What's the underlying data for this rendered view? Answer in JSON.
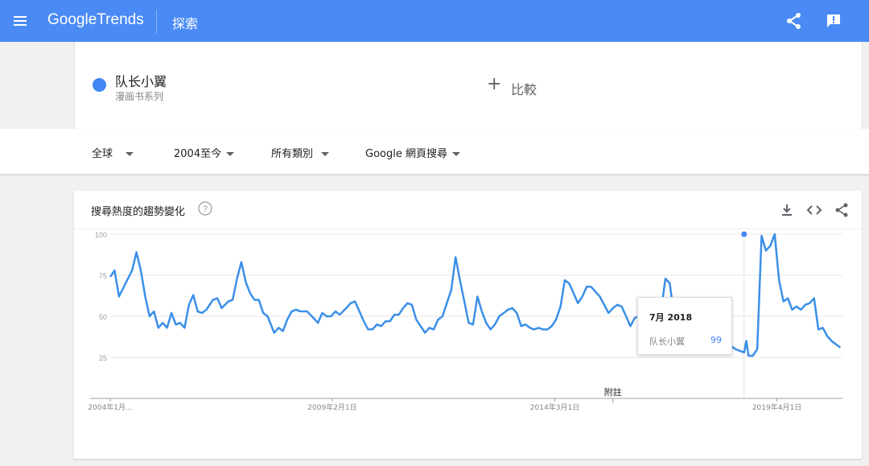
{
  "topbar": {
    "menu_icon": "hamburger-icon",
    "logo_google": "Google",
    "logo_trends": "Trends",
    "app_title": "探索",
    "share_icon": "share-icon",
    "feedback_icon": "feedback-icon"
  },
  "term": {
    "name": "队长小翼",
    "type": "漫画书系列",
    "color": "#4285f4"
  },
  "compare": {
    "label": "比較",
    "icon": "plus-icon"
  },
  "filters": [
    {
      "label": "全球"
    },
    {
      "label": "2004至今"
    },
    {
      "label": "所有類別"
    },
    {
      "label": "Google 網頁搜尋"
    }
  ],
  "chart": {
    "title": "搜尋熱度的趨勢變化",
    "download_icon": "download-icon",
    "embed_icon": "embed-code-icon",
    "share_icon": "share-icon",
    "help_icon": "help-icon",
    "annotation_label": "附註"
  },
  "tooltip": {
    "date": "7月 2018",
    "term": "队长小翼",
    "value": "99"
  },
  "chart_data": {
    "type": "line",
    "line_color": "#3b8fe8",
    "ylim": [
      0,
      100
    ],
    "yticks": [
      100,
      75,
      50,
      25
    ],
    "xtick_labels": [
      {
        "label": "2004年1月...",
        "year": 2004.0
      },
      {
        "label": "2009年2月1日",
        "year": 2009.08
      },
      {
        "label": "2014年3月1日",
        "year": 2014.17
      },
      {
        "label": "2019年4月1日",
        "year": 2019.25
      }
    ],
    "x_start": 2004.0,
    "x_end": 2020.75,
    "highlight": {
      "year": 2018.5,
      "value": 100
    },
    "annotation_year": 2015.5,
    "series": [
      {
        "name": "队长小翼",
        "points": [
          [
            2004.0,
            74
          ],
          [
            2004.1,
            78
          ],
          [
            2004.2,
            62
          ],
          [
            2004.35,
            70
          ],
          [
            2004.5,
            78
          ],
          [
            2004.6,
            89
          ],
          [
            2004.7,
            78
          ],
          [
            2004.8,
            62
          ],
          [
            2004.9,
            50
          ],
          [
            2005.0,
            53
          ],
          [
            2005.1,
            43
          ],
          [
            2005.2,
            46
          ],
          [
            2005.3,
            43
          ],
          [
            2005.4,
            52
          ],
          [
            2005.5,
            45
          ],
          [
            2005.6,
            46
          ],
          [
            2005.7,
            43
          ],
          [
            2005.8,
            57
          ],
          [
            2005.9,
            63
          ],
          [
            2006.0,
            53
          ],
          [
            2006.1,
            52
          ],
          [
            2006.2,
            54
          ],
          [
            2006.35,
            60
          ],
          [
            2006.45,
            61
          ],
          [
            2006.55,
            55
          ],
          [
            2006.7,
            59
          ],
          [
            2006.8,
            60
          ],
          [
            2006.9,
            73
          ],
          [
            2007.0,
            83
          ],
          [
            2007.1,
            71
          ],
          [
            2007.2,
            64
          ],
          [
            2007.3,
            60
          ],
          [
            2007.4,
            60
          ],
          [
            2007.5,
            52
          ],
          [
            2007.6,
            50
          ],
          [
            2007.75,
            40
          ],
          [
            2007.85,
            43
          ],
          [
            2007.95,
            41
          ],
          [
            2008.05,
            48
          ],
          [
            2008.15,
            53
          ],
          [
            2008.25,
            54
          ],
          [
            2008.35,
            53
          ],
          [
            2008.5,
            53
          ],
          [
            2008.65,
            49
          ],
          [
            2008.75,
            46
          ],
          [
            2008.85,
            52
          ],
          [
            2008.95,
            50
          ],
          [
            2009.05,
            50
          ],
          [
            2009.15,
            53
          ],
          [
            2009.25,
            51
          ],
          [
            2009.4,
            55
          ],
          [
            2009.5,
            58
          ],
          [
            2009.6,
            59
          ],
          [
            2009.7,
            53
          ],
          [
            2009.8,
            47
          ],
          [
            2009.9,
            42
          ],
          [
            2010.0,
            42
          ],
          [
            2010.1,
            45
          ],
          [
            2010.2,
            44
          ],
          [
            2010.3,
            47
          ],
          [
            2010.4,
            47
          ],
          [
            2010.5,
            51
          ],
          [
            2010.6,
            51
          ],
          [
            2010.7,
            55
          ],
          [
            2010.8,
            58
          ],
          [
            2010.9,
            57
          ],
          [
            2011.0,
            48
          ],
          [
            2011.1,
            44
          ],
          [
            2011.2,
            40
          ],
          [
            2011.3,
            43
          ],
          [
            2011.4,
            42
          ],
          [
            2011.5,
            48
          ],
          [
            2011.6,
            50
          ],
          [
            2011.7,
            58
          ],
          [
            2011.8,
            66
          ],
          [
            2011.9,
            86
          ],
          [
            2012.0,
            72
          ],
          [
            2012.1,
            59
          ],
          [
            2012.2,
            46
          ],
          [
            2012.3,
            45
          ],
          [
            2012.4,
            62
          ],
          [
            2012.5,
            53
          ],
          [
            2012.6,
            46
          ],
          [
            2012.7,
            42
          ],
          [
            2012.8,
            45
          ],
          [
            2012.9,
            50
          ],
          [
            2013.0,
            52
          ],
          [
            2013.1,
            54
          ],
          [
            2013.2,
            55
          ],
          [
            2013.3,
            52
          ],
          [
            2013.4,
            44
          ],
          [
            2013.5,
            45
          ],
          [
            2013.6,
            43
          ],
          [
            2013.7,
            42
          ],
          [
            2013.8,
            43
          ],
          [
            2013.9,
            42
          ],
          [
            2014.0,
            42
          ],
          [
            2014.1,
            44
          ],
          [
            2014.2,
            48
          ],
          [
            2014.3,
            56
          ],
          [
            2014.4,
            72
          ],
          [
            2014.5,
            70
          ],
          [
            2014.6,
            64
          ],
          [
            2014.7,
            58
          ],
          [
            2014.8,
            62
          ],
          [
            2014.9,
            68
          ],
          [
            2015.0,
            68
          ],
          [
            2015.1,
            65
          ],
          [
            2015.2,
            62
          ],
          [
            2015.3,
            57
          ],
          [
            2015.4,
            52
          ],
          [
            2015.5,
            55
          ],
          [
            2015.6,
            57
          ],
          [
            2015.7,
            56
          ],
          [
            2015.8,
            50
          ],
          [
            2015.9,
            44
          ],
          [
            2016.0,
            49
          ],
          [
            2016.1,
            50
          ],
          [
            2016.2,
            52
          ],
          [
            2016.3,
            52
          ],
          [
            2016.4,
            50
          ],
          [
            2016.5,
            49
          ],
          [
            2016.6,
            53
          ],
          [
            2016.7,
            73
          ],
          [
            2016.8,
            70
          ],
          [
            2016.9,
            50
          ],
          [
            2017.0,
            43
          ],
          [
            2017.1,
            40
          ],
          [
            2017.2,
            39
          ],
          [
            2017.3,
            40
          ],
          [
            2017.4,
            40
          ],
          [
            2017.5,
            39
          ],
          [
            2017.6,
            38
          ],
          [
            2017.7,
            40
          ],
          [
            2017.8,
            42
          ],
          [
            2017.9,
            47
          ],
          [
            2018.0,
            54
          ],
          [
            2018.1,
            40
          ],
          [
            2018.2,
            32
          ],
          [
            2018.3,
            30
          ],
          [
            2018.4,
            29
          ],
          [
            2018.5,
            28
          ],
          [
            2018.55,
            35
          ],
          [
            2018.6,
            26
          ],
          [
            2018.7,
            26
          ],
          [
            2018.8,
            30
          ],
          [
            2018.9,
            99
          ],
          [
            2019.0,
            90
          ],
          [
            2019.1,
            93
          ],
          [
            2019.2,
            100
          ],
          [
            2019.3,
            72
          ],
          [
            2019.4,
            59
          ],
          [
            2019.5,
            61
          ],
          [
            2019.6,
            54
          ],
          [
            2019.7,
            56
          ],
          [
            2019.8,
            54
          ],
          [
            2019.9,
            57
          ],
          [
            2020.0,
            58
          ],
          [
            2020.1,
            61
          ],
          [
            2020.2,
            42
          ],
          [
            2020.3,
            43
          ],
          [
            2020.4,
            38
          ],
          [
            2020.5,
            35
          ],
          [
            2020.6,
            33
          ],
          [
            2020.7,
            31
          ]
        ]
      }
    ]
  }
}
